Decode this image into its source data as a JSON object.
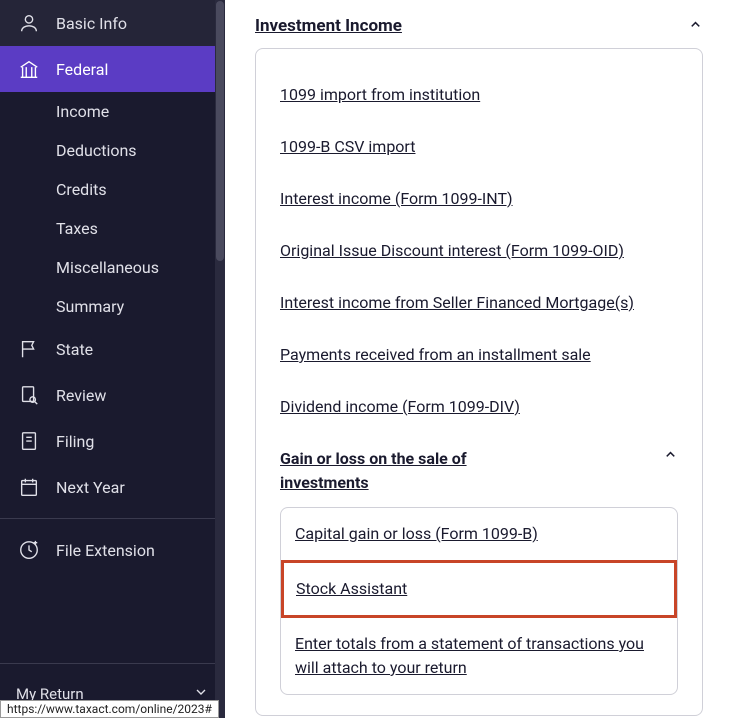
{
  "sidebar": {
    "items": [
      {
        "label": "Basic Info",
        "icon": "person"
      },
      {
        "label": "Federal",
        "icon": "building"
      },
      {
        "label": "State",
        "icon": "flag"
      },
      {
        "label": "Review",
        "icon": "search-doc"
      },
      {
        "label": "Filing",
        "icon": "filing"
      },
      {
        "label": "Next Year",
        "icon": "calendar"
      },
      {
        "label": "File Extension",
        "icon": "clock"
      }
    ],
    "federal_subitems": [
      {
        "label": "Income"
      },
      {
        "label": "Deductions"
      },
      {
        "label": "Credits"
      },
      {
        "label": "Taxes"
      },
      {
        "label": "Miscellaneous"
      },
      {
        "label": "Summary"
      }
    ],
    "footer": {
      "my_return": "My Return"
    }
  },
  "main": {
    "section_title": "Investment Income",
    "links": [
      "1099 import from institution",
      "1099-B CSV import",
      "Interest income (Form 1099-INT)",
      "Original Issue Discount interest (Form 1099-OID)",
      "Interest income from Seller Financed Mortgage(s)",
      "Payments received from an installment sale",
      "Dividend income (Form 1099-DIV)"
    ],
    "sub_section_title": "Gain or loss on the sale of investments",
    "sub_links": [
      "Capital gain or loss (Form 1099-B)",
      "Stock Assistant",
      "Enter totals from a statement of transactions you will attach to your return"
    ]
  },
  "status_url": "https://www.taxact.com/online/2023#"
}
